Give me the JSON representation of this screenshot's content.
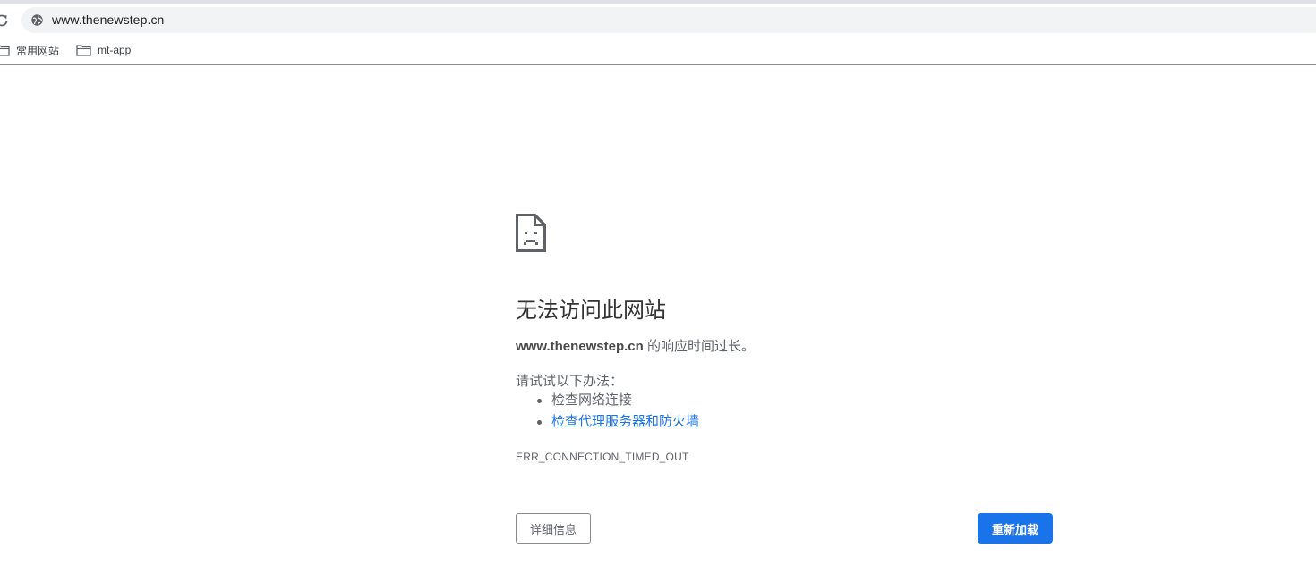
{
  "browser": {
    "url": "www.thenewstep.cn",
    "reload_icon": "reload-icon",
    "site_info_icon": "globe-icon"
  },
  "bookmarks": [
    {
      "label": "常用网站",
      "icon": "folder-icon"
    },
    {
      "label": "mt-app",
      "icon": "folder-icon"
    }
  ],
  "error_page": {
    "icon": "sad-page-icon",
    "title": "无法访问此网站",
    "host": "www.thenewstep.cn",
    "description_suffix": " 的响应时间过长。",
    "suggestions_heading": "请试试以下办法：",
    "suggestions": [
      {
        "text": "检查网络连接",
        "is_link": false
      },
      {
        "text": "检查代理服务器和防火墙",
        "is_link": true
      }
    ],
    "error_code": "ERR_CONNECTION_TIMED_OUT",
    "details_button": "详细信息",
    "reload_button": "重新加载"
  },
  "colors": {
    "accent": "#1a73e8",
    "text": "#5f6368",
    "omnibox_bg": "#f1f3f4"
  }
}
